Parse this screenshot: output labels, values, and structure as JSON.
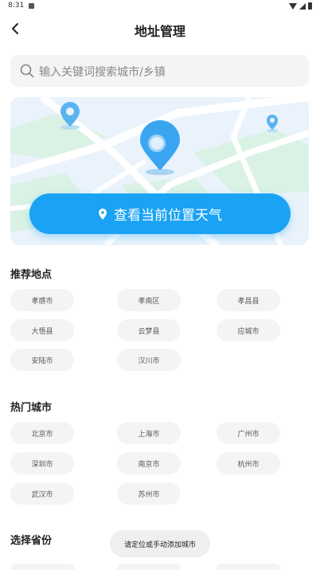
{
  "status": {
    "time": "8:31"
  },
  "header": {
    "title": "地址管理"
  },
  "search": {
    "placeholder": "输入关键词搜索城市/乡镇"
  },
  "location_button": {
    "label": "查看当前位置天气"
  },
  "recommended": {
    "title": "推荐地点",
    "items": [
      "孝感市",
      "孝南区",
      "孝昌县",
      "大悟县",
      "云梦县",
      "应城市",
      "安陆市",
      "汉川市"
    ]
  },
  "hot_cities": {
    "title": "热门城市",
    "items": [
      "北京市",
      "上海市",
      "广州市",
      "深圳市",
      "南京市",
      "杭州市",
      "武汉市",
      "苏州市"
    ]
  },
  "provinces": {
    "title": "选择省份"
  },
  "toast": {
    "text": "请定位或手动添加城市"
  },
  "colors": {
    "accent": "#1aa3f4",
    "chip_bg": "#f3f4f6",
    "map_bg": "#eaf3fb",
    "map_green": "#d9f2e4"
  }
}
